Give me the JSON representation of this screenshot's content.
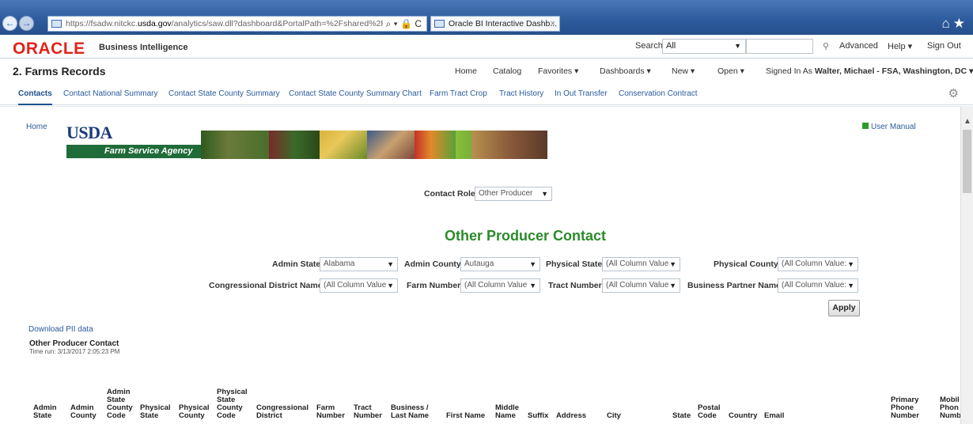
{
  "browser": {
    "url_host_prefix": "https://fsadw.nitckc.",
    "url_host": "usda.gov",
    "url_rest": "/analytics/saw.dll?dashboard&PortalPath=%2Fshared%2FFarm!",
    "addr_tools": "⌕ ▾ 🔒 C",
    "tab_title": "Oracle BI Interactive Dashb...",
    "tab_close": "×",
    "chrome_icons": "⌂★"
  },
  "header": {
    "oracle": "ORACLE",
    "product": "Business Intelligence",
    "search_label": "Search",
    "search_scope": "All",
    "advanced": "Advanced",
    "help": "Help ▾",
    "sign_out": "Sign Out"
  },
  "dashboard": {
    "title": "2. Farms Records",
    "menu": {
      "home": "Home",
      "catalog": "Catalog",
      "favorites": "Favorites ▾",
      "dashboards": "Dashboards ▾",
      "new": "New ▾",
      "open": "Open ▾"
    },
    "signed_in_label": "Signed In As",
    "signed_in_user": "Walter, Michael - FSA, Washington, DC ▾"
  },
  "tabs": [
    "Contacts",
    "Contact National Summary",
    "Contact State County Summary",
    "Contact State County Summary Chart",
    "Farm Tract Crop",
    "Tract History",
    "In Out Transfer",
    "Conservation Contract"
  ],
  "content": {
    "home_link": "Home",
    "usda": "USDA",
    "fsa": "Farm Service Agency",
    "user_manual": "User Manual",
    "contact_role_label": "Contact Role",
    "contact_role_value": "Other Producer",
    "report_title": "Other Producer Contact",
    "prompts": {
      "admin_state": {
        "label": "Admin State",
        "value": "Alabama"
      },
      "admin_county": {
        "label": "Admin County",
        "value": "Autauga"
      },
      "physical_state": {
        "label": "Physical State",
        "value": "(All Column Value"
      },
      "physical_county": {
        "label": "Physical County",
        "value": "(All Column Value:"
      },
      "congressional_district": {
        "label": "Congressional District Name",
        "value": "(All Column Value"
      },
      "farm_number": {
        "label": "Farm Number",
        "value": "(All Column Value"
      },
      "tract_number": {
        "label": "Tract Number",
        "value": "(All Column Value"
      },
      "business_partner": {
        "label": "Business Partner Name",
        "value": "(All Column Value:"
      }
    },
    "apply": "Apply",
    "download_pii": "Download PII data",
    "sub_title": "Other Producer Contact",
    "time_run": "Time run: 3/13/2017 2:05:23 PM"
  },
  "table": {
    "columns": [
      "Admin\nState",
      "Admin\nCounty",
      "Admin\nState\nCounty\nCode",
      "Physical\nState",
      "Physical\nCounty",
      "Physical\nState\nCounty\nCode",
      "Congressional\nDistrict",
      "Farm\nNumber",
      "Tract\nNumber",
      "Business /\nLast Name",
      "First Name",
      "Middle\nName",
      "Suffix",
      "Address",
      "City",
      "State",
      "Postal\nCode",
      "Country",
      "Email",
      "Primary\nPhone\nNumber",
      "Mobil\nPhon\nNumb"
    ]
  },
  "colors": {
    "oracle_red": "#e2231a",
    "report_green": "#2a8a2a",
    "link_blue": "#2a5a9c",
    "browser_blue": "#2d5a9c"
  }
}
